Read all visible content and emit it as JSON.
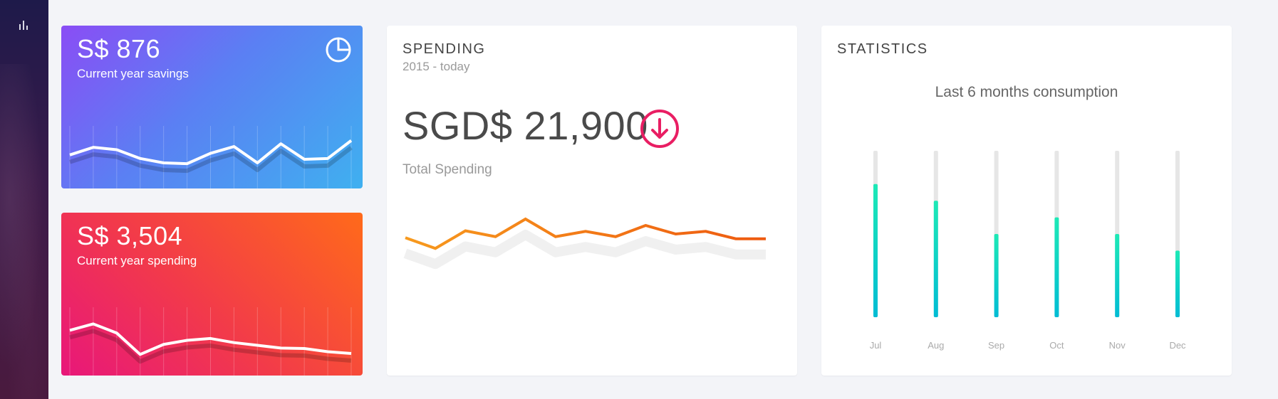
{
  "sidebar": {
    "icon": "bar-chart-icon"
  },
  "cards": {
    "savings": {
      "value": "S$ 876",
      "label": "Current year savings",
      "icon": "pie-chart-icon",
      "spark": [
        0.55,
        0.36,
        0.42,
        0.64,
        0.75,
        0.77,
        0.51,
        0.34,
        0.75,
        0.27,
        0.66,
        0.64,
        0.19
      ]
    },
    "spending": {
      "value": "S$ 3,504",
      "label": "Current year spending",
      "spark": [
        0.35,
        0.21,
        0.41,
        0.88,
        0.66,
        0.57,
        0.53,
        0.62,
        0.68,
        0.74,
        0.75,
        0.82,
        0.86
      ]
    }
  },
  "spending_panel": {
    "title": "SPENDING",
    "subtitle": "2015 - today",
    "amount": "SGD$ 21,900",
    "trend_icon": "arrow-down-circle-icon",
    "caption": "Total Spending",
    "line": [
      0.35,
      0.55,
      0.22,
      0.33,
      0.0,
      0.33,
      0.23,
      0.33,
      0.12,
      0.28,
      0.23,
      0.37,
      0.37
    ]
  },
  "stats_panel": {
    "title": "STATISTICS"
  },
  "chart_data": {
    "type": "bar",
    "title": "Last 6 months consumption",
    "categories": [
      "Jul",
      "Aug",
      "Sep",
      "Oct",
      "Nov",
      "Dec"
    ],
    "values": [
      80,
      70,
      50,
      60,
      50,
      40
    ],
    "ylim": [
      0,
      100
    ]
  },
  "colors": {
    "accent_red": "#e91e63",
    "bar_top": "#1de9b6",
    "bar_bottom": "#00bcd4",
    "track": "#e6e6e6",
    "line_orange": "#f06a10"
  }
}
